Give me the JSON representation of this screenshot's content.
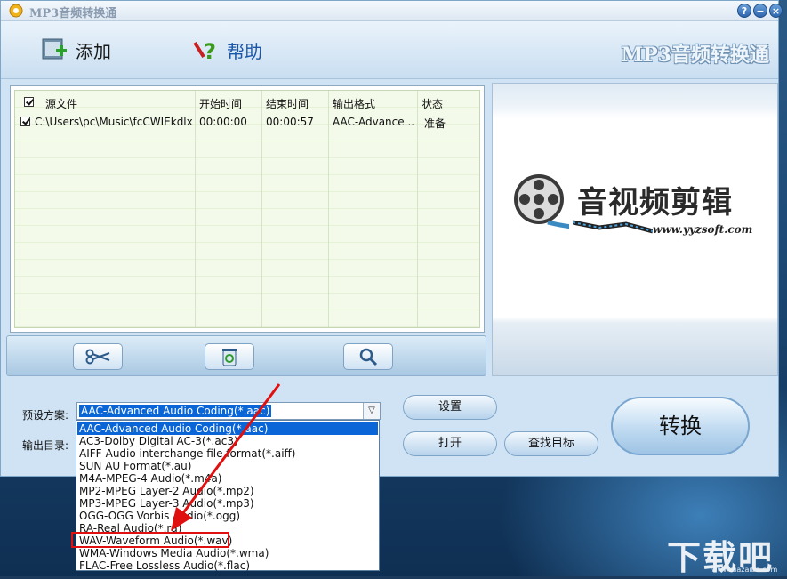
{
  "window": {
    "title": "MP3音频转换通",
    "help_btn": "?",
    "min_btn": "−",
    "close_btn": "×"
  },
  "toolbar": {
    "add_label": "添加",
    "help_label": "帮助",
    "brand": "MP3音频转换通"
  },
  "file_list": {
    "headers": [
      "源文件",
      "开始时间",
      "结束时间",
      "输出格式",
      "状态"
    ],
    "rows": [
      {
        "source": "C:\\Users\\pc\\Music\\fcCWIEkdlx...",
        "start": "00:00:00",
        "end": "00:00:57",
        "format": "AAC-Advance...",
        "status": "准备"
      }
    ]
  },
  "preview": {
    "title": "音视频剪辑",
    "url": "www.yyzsoft.com"
  },
  "settings": {
    "preset_label": "预设方案:",
    "output_label": "输出目录:",
    "preset_value": "AAC-Advanced Audio Coding(*.aac)",
    "settings_btn": "设置",
    "open_btn": "打开",
    "find_btn": "查找目标",
    "convert_btn": "转换"
  },
  "dropdown": {
    "options": [
      "AAC-Advanced Audio Coding(*.aac)",
      "AC3-Dolby Digital AC-3(*.ac3)",
      "AIFF-Audio interchange file format(*.aiff)",
      "SUN AU Format(*.au)",
      "M4A-MPEG-4 Audio(*.m4a)",
      "MP2-MPEG Layer-2 Audio(*.mp2)",
      "MP3-MPEG Layer-3 Audio(*.mp3)",
      "OGG-OGG Vorbis Audio(*.ogg)",
      "RA-Real Audio(*.ra)",
      "WAV-Waveform Audio(*.wav)",
      "WMA-Windows Media Audio(*.wma)",
      "FLAC-Free Lossless Audio(*.flac)"
    ],
    "selected_index": 0,
    "highlighted_index": 9
  },
  "watermark": {
    "text": "下载吧",
    "url": "www.xiazaiba.com"
  },
  "colors": {
    "selection": "#0a66d6",
    "annotation": "#e01010",
    "window_bg": "#cfe3f4"
  }
}
